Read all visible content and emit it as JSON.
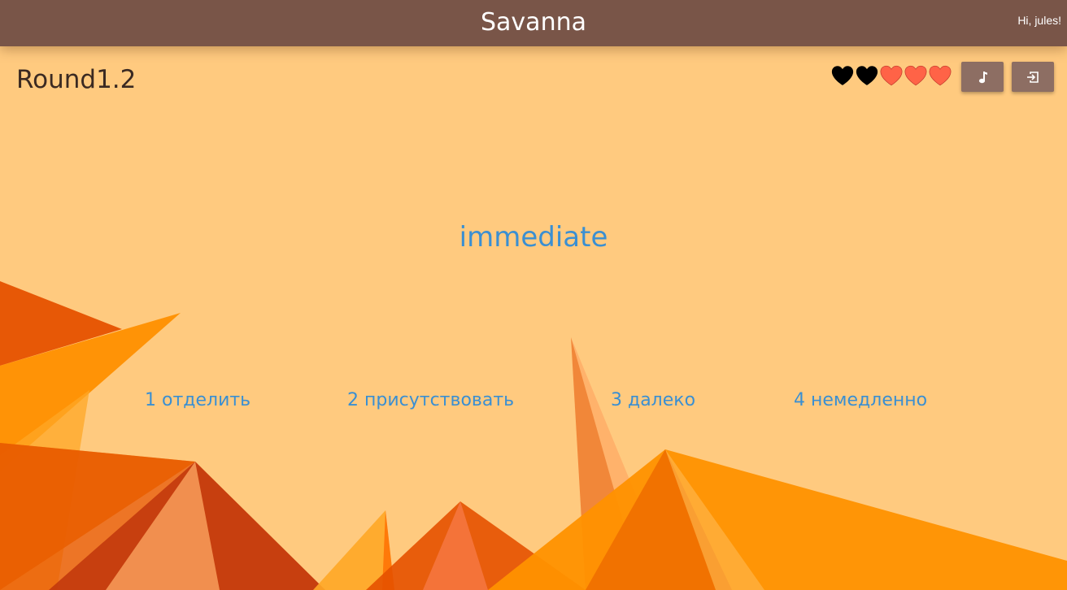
{
  "header": {
    "title": "Savanna",
    "greeting": "Hi, jules!"
  },
  "game": {
    "round_label": "Round1.2",
    "lives": {
      "total": 5,
      "lost": 2,
      "remaining": 3,
      "lost_color": "#000000",
      "remaining_color": "#ff6347"
    },
    "controls": {
      "music_icon": "music-note-icon",
      "exit_icon": "exit-icon"
    },
    "word": "immediate",
    "options": [
      {
        "number": "1",
        "text": "отделить",
        "label": "1 отделить"
      },
      {
        "number": "2",
        "text": "присутствовать",
        "label": "2 присутствовать"
      },
      {
        "number": "3",
        "text": "далеко",
        "label": "3 далеко"
      },
      {
        "number": "4",
        "text": "немедленно",
        "label": "4 немедленно"
      }
    ]
  },
  "colors": {
    "header_background": "#795548",
    "button_background": "#8d6e63",
    "page_background": "#ffca7f",
    "word_color": "#3a8fd2"
  }
}
